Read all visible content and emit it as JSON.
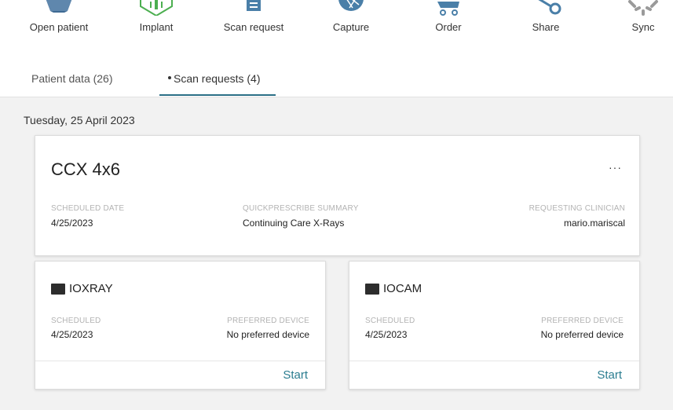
{
  "toolbar": {
    "items": [
      {
        "label": "Open patient",
        "icon": "folder-icon"
      },
      {
        "label": "Implant",
        "icon": "implant-icon"
      },
      {
        "label": "Scan request",
        "icon": "document-icon"
      },
      {
        "label": "Capture",
        "icon": "aperture-icon"
      },
      {
        "label": "Order",
        "icon": "cart-icon"
      },
      {
        "label": "Share",
        "icon": "share-icon"
      },
      {
        "label": "Sync",
        "icon": "sync-spinner-icon"
      }
    ]
  },
  "tabs": [
    {
      "label": "Patient data (26)",
      "active": false
    },
    {
      "label": "Scan requests (4)",
      "active": true
    }
  ],
  "content": {
    "date_heading": "Tuesday, 25 April 2023",
    "request": {
      "title": "CCX 4x6",
      "more": "···",
      "fields": [
        {
          "label": "SCHEDULED DATE",
          "value": "4/25/2023"
        },
        {
          "label": "QUICKPRESCRIBE SUMMARY",
          "value": "Continuing Care X-Rays"
        },
        {
          "label": "REQUESTING CLINICIAN",
          "value": "mario.mariscal"
        }
      ]
    },
    "devices": [
      {
        "name": "IOXRAY",
        "icon": "xray-sensor-icon",
        "scheduled_label": "SCHEDULED",
        "scheduled_value": "4/25/2023",
        "preferred_label": "PREFERRED DEVICE",
        "preferred_value": "No preferred device",
        "action": "Start"
      },
      {
        "name": "IOCAM",
        "icon": "intraoral-camera-icon",
        "scheduled_label": "SCHEDULED",
        "scheduled_value": "4/25/2023",
        "preferred_label": "PREFERRED DEVICE",
        "preferred_value": "No preferred device",
        "action": "Start"
      }
    ]
  },
  "colors": {
    "accent": "#2b7d90",
    "implant_green": "#4caf50",
    "icon_blue": "#4a7fa8",
    "background": "#f2f2f2"
  }
}
